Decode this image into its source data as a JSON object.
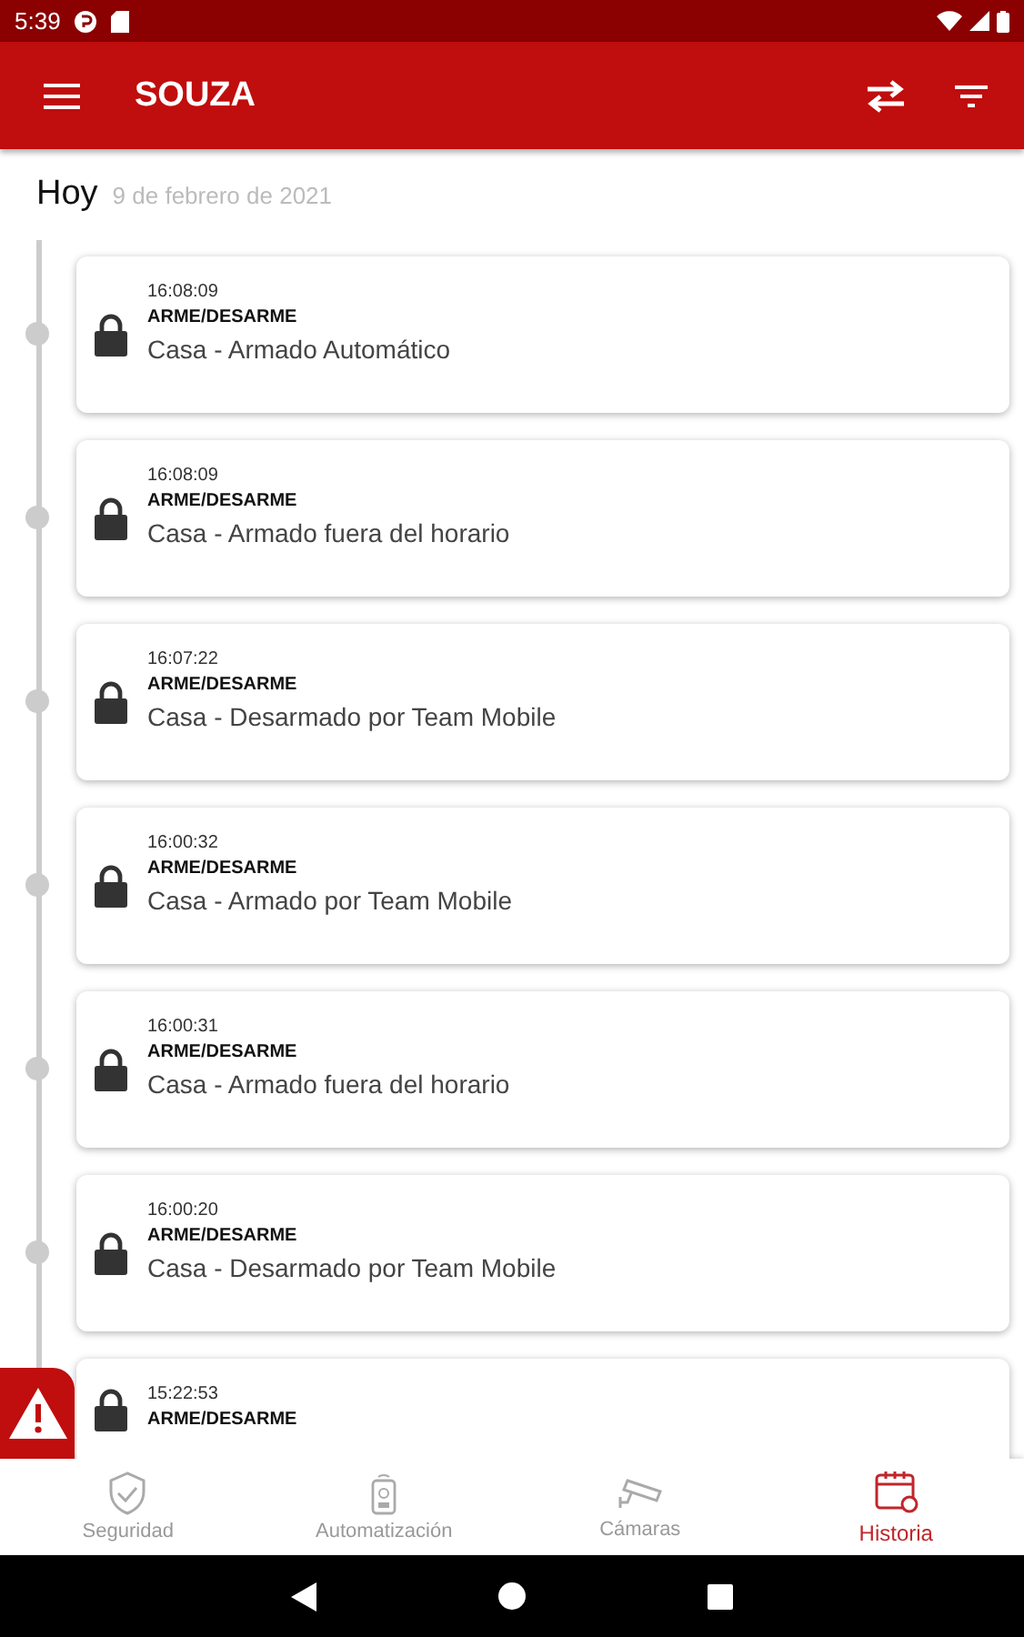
{
  "status_bar": {
    "time": "5:39"
  },
  "app_bar": {
    "title": "SOUZA"
  },
  "day_header": {
    "label": "Hoy",
    "date": "9 de febrero de 2021"
  },
  "events": [
    {
      "time": "16:08:09",
      "type": "ARME/DESARME",
      "message": "Casa - Armado Automático"
    },
    {
      "time": "16:08:09",
      "type": "ARME/DESARME",
      "message": "Casa - Armado fuera del horario"
    },
    {
      "time": "16:07:22",
      "type": "ARME/DESARME",
      "message": "Casa - Desarmado por Team Mobile"
    },
    {
      "time": "16:00:32",
      "type": "ARME/DESARME",
      "message": "Casa - Armado por Team Mobile"
    },
    {
      "time": "16:00:31",
      "type": "ARME/DESARME",
      "message": "Casa - Armado fuera del horario"
    },
    {
      "time": "16:00:20",
      "type": "ARME/DESARME",
      "message": "Casa - Desarmado por Team Mobile"
    },
    {
      "time": "15:22:53",
      "type": "ARME/DESARME"
    }
  ],
  "bottom_nav": [
    {
      "kind": "shield",
      "label": "Seguridad",
      "selected": false
    },
    {
      "kind": "remote",
      "label": "Automatización",
      "selected": false
    },
    {
      "kind": "camera",
      "label": "Cámaras",
      "selected": false
    },
    {
      "kind": "calendar",
      "label": "Historia",
      "selected": true
    }
  ]
}
